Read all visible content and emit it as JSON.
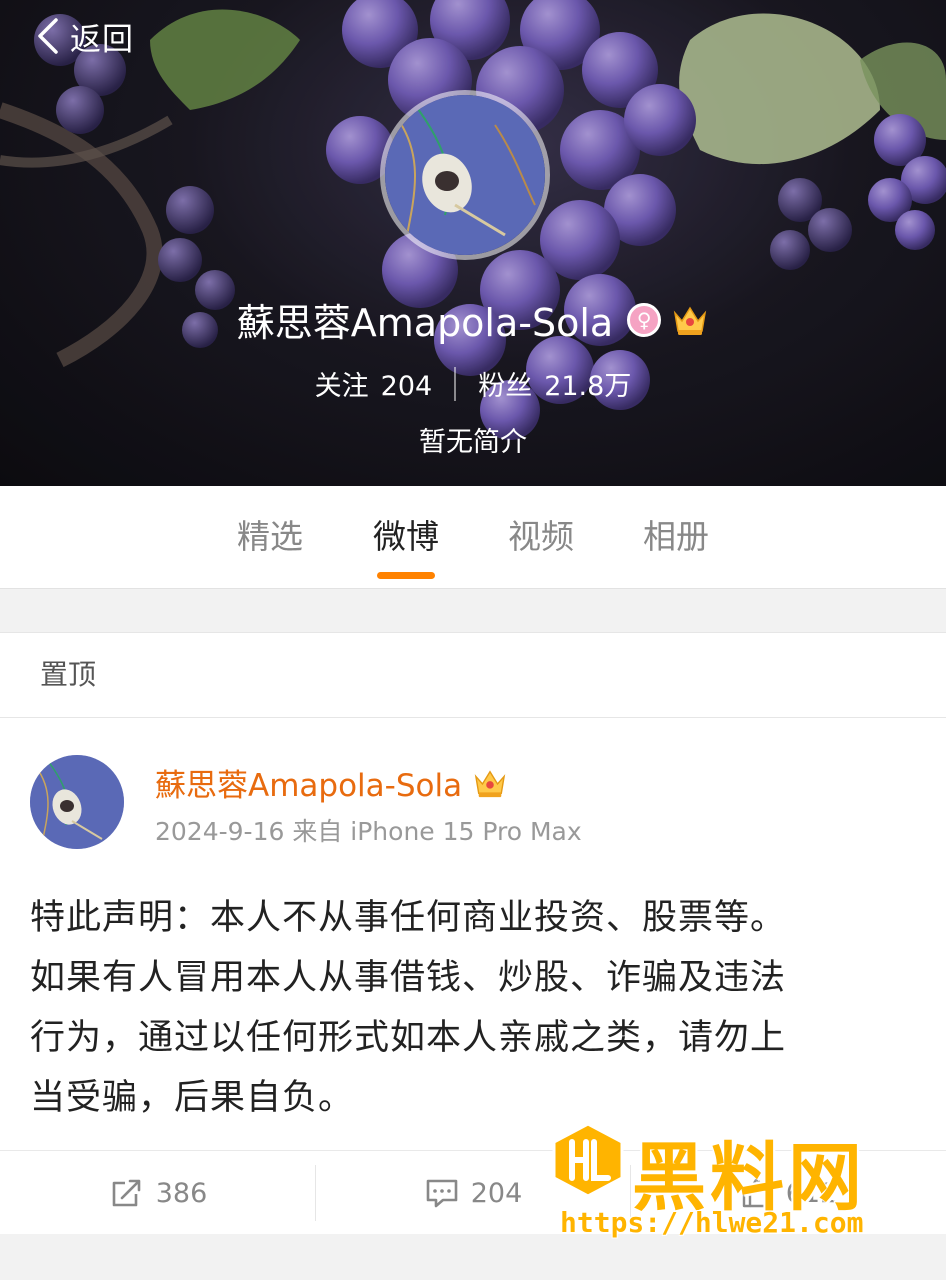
{
  "header": {
    "back_label": "返回",
    "profile_name": "蘇思蓉Amapola-Sola",
    "following_label": "关注",
    "following_count": "204",
    "followers_label": "粉丝",
    "followers_count": "21.8万",
    "intro": "暂无简介"
  },
  "tabs": [
    {
      "label": "精选",
      "active": false
    },
    {
      "label": "微博",
      "active": true
    },
    {
      "label": "视频",
      "active": false
    },
    {
      "label": "相册",
      "active": false
    }
  ],
  "pinned_label": "置顶",
  "post": {
    "author": "蘇思蓉Amapola-Sola",
    "meta": "2024-9-16 来自 iPhone 15 Pro Max",
    "lines": [
      "特此声明：本人不从事任何商业投资、股票等。",
      "如果有人冒用本人从事借钱、炒股、诈骗及违法",
      "行为，通过以任何形式如本人亲戚之类，请勿上",
      "当受骗，后果自负。"
    ],
    "reposts": "386",
    "comments": "204",
    "likes": "612"
  },
  "watermark": {
    "title": "黑料网",
    "url": "https://hlwe21.com"
  },
  "colors": {
    "accent": "#ff8200",
    "author": "#e86b0f",
    "watermark": "#ffb400"
  }
}
